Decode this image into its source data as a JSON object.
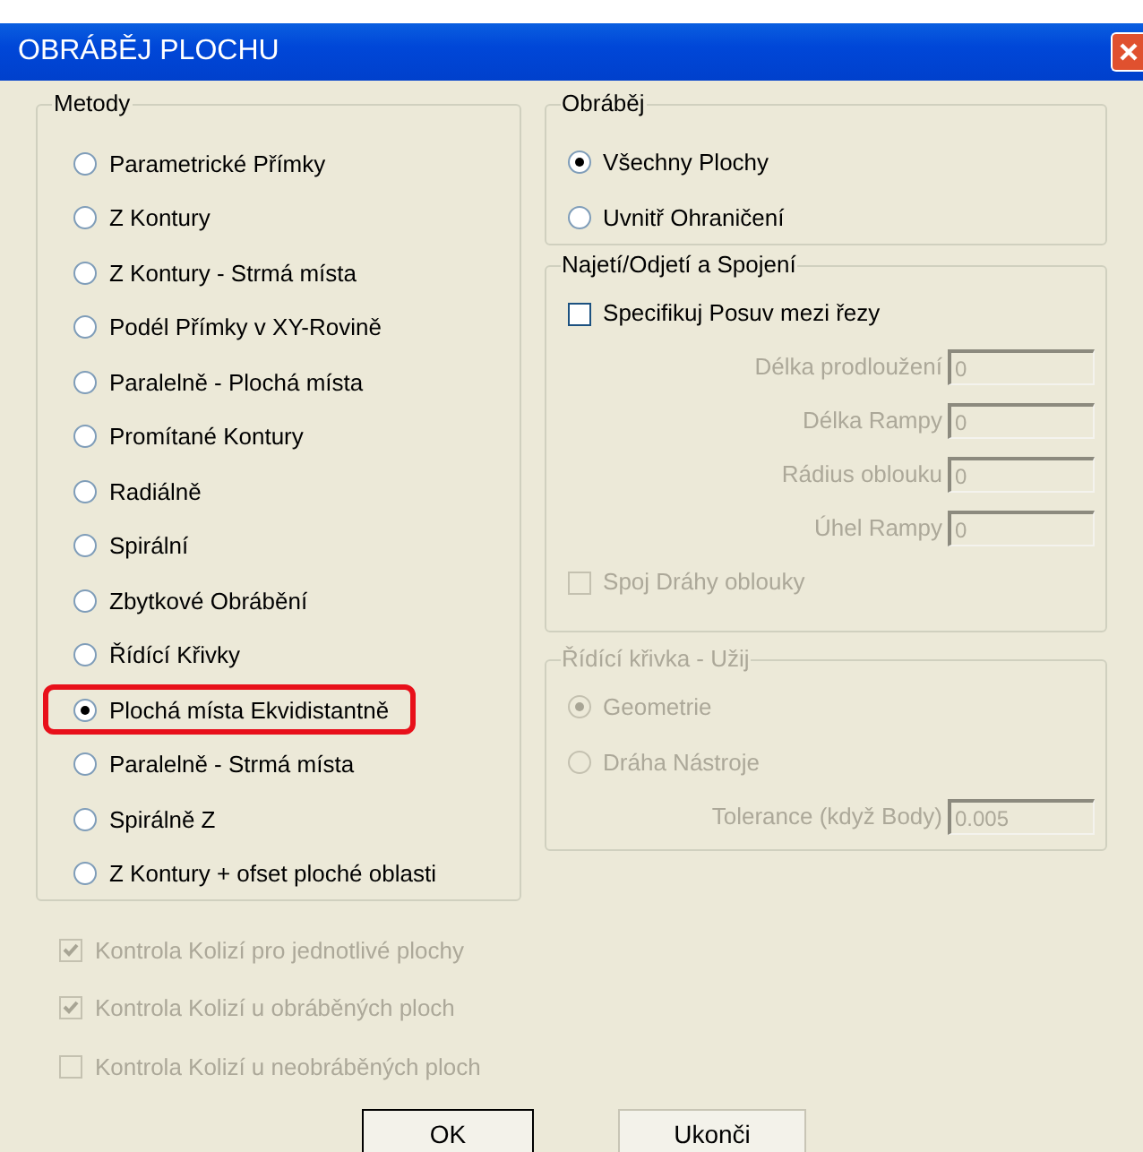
{
  "window": {
    "title": "OBRÁBĚJ PLOCHU"
  },
  "methods": {
    "label": "Metody",
    "items": [
      {
        "label": "Parametrické Přímky",
        "selected": false,
        "highlighted": false
      },
      {
        "label": "Z Kontury",
        "selected": false,
        "highlighted": false
      },
      {
        "label": "Z Kontury - Strmá místa",
        "selected": false,
        "highlighted": false
      },
      {
        "label": "Podél Přímky v XY-Rovině",
        "selected": false,
        "highlighted": false
      },
      {
        "label": "Paralelně - Plochá místa",
        "selected": false,
        "highlighted": false
      },
      {
        "label": "Promítané Kontury",
        "selected": false,
        "highlighted": false
      },
      {
        "label": "Radiálně",
        "selected": false,
        "highlighted": false
      },
      {
        "label": "Spirální",
        "selected": false,
        "highlighted": false
      },
      {
        "label": "Zbytkové Obrábění",
        "selected": false,
        "highlighted": false
      },
      {
        "label": "Řídící Křivky",
        "selected": false,
        "highlighted": false
      },
      {
        "label": "Plochá místa Ekvidistantně",
        "selected": true,
        "highlighted": true
      },
      {
        "label": "Paralelně - Strmá místa",
        "selected": false,
        "highlighted": false
      },
      {
        "label": "Spirálně Z",
        "selected": false,
        "highlighted": false
      },
      {
        "label": "Z Kontury + ofset ploché oblasti",
        "selected": false,
        "highlighted": false
      }
    ]
  },
  "checks": [
    {
      "label": "Kontrola Kolizí pro jednotlivé plochy",
      "checked": true,
      "disabled": true
    },
    {
      "label": "Kontrola Kolizí u obráběných ploch",
      "checked": true,
      "disabled": true
    },
    {
      "label": "Kontrola Kolizí u neobráběných ploch",
      "checked": false,
      "disabled": true
    }
  ],
  "machine": {
    "label": "Obráběj",
    "items": [
      {
        "label": "Všechny Plochy",
        "selected": true
      },
      {
        "label": "Uvnitř Ohraničení",
        "selected": false
      }
    ]
  },
  "approach": {
    "label": "Najetí/Odjetí a Spojení",
    "rows": [
      {
        "kind": "checkbox",
        "label": "Specifikuj Posuv mezi řezy",
        "checked": false,
        "disabled": false
      },
      {
        "kind": "field",
        "label": "Délka prodloužení",
        "value": "0",
        "disabled": true
      },
      {
        "kind": "field",
        "label": "Délka Rampy",
        "value": "0",
        "disabled": true
      },
      {
        "kind": "field",
        "label": "Rádius oblouku",
        "value": "0",
        "disabled": true
      },
      {
        "kind": "field",
        "label": "Úhel Rampy",
        "value": "0",
        "disabled": true
      },
      {
        "kind": "checkbox",
        "label": "Spoj Dráhy oblouky",
        "checked": false,
        "disabled": true
      }
    ]
  },
  "curve": {
    "label": "Řídící křivka - Užij",
    "disabled": true,
    "rows": [
      {
        "kind": "radio",
        "label": "Geometrie",
        "selected": true,
        "disabled": true
      },
      {
        "kind": "radio",
        "label": "Dráha Nástroje",
        "selected": false,
        "disabled": true
      },
      {
        "kind": "field",
        "label": "Tolerance (když Body)",
        "value": "0.005",
        "disabled": true
      }
    ]
  },
  "buttons": [
    "OK",
    "Ukonči"
  ]
}
